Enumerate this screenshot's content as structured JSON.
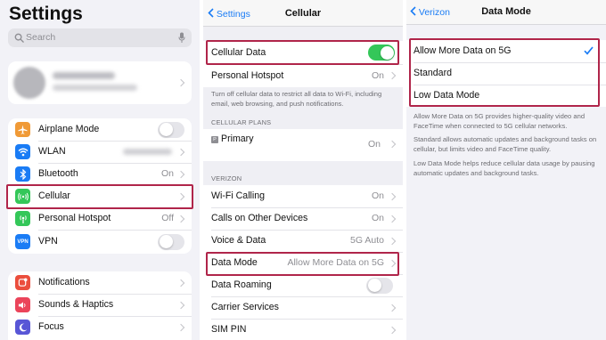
{
  "settings": {
    "title": "Settings",
    "search_placeholder": "Search",
    "group1": [
      {
        "label": "Airplane Mode",
        "icon": "airplane-icon",
        "color": "#f09a37",
        "control": "toggle",
        "on": false
      },
      {
        "label": "WLAN",
        "icon": "wifi-icon",
        "color": "#1a7cf5",
        "control": "blurred"
      },
      {
        "label": "Bluetooth",
        "icon": "bluetooth-icon",
        "color": "#1a7cf5",
        "value": "On"
      },
      {
        "label": "Cellular",
        "icon": "cellular-icon",
        "color": "#34c759"
      },
      {
        "label": "Personal Hotspot",
        "icon": "hotspot-icon",
        "color": "#34c759",
        "value": "Off"
      },
      {
        "label": "VPN",
        "icon": "vpn-icon",
        "color": "#1a7cf5",
        "control": "toggle",
        "on": false
      }
    ],
    "group2": [
      {
        "label": "Notifications",
        "icon": "bell-icon",
        "color": "#eb4e3d"
      },
      {
        "label": "Sounds & Haptics",
        "icon": "speaker-icon",
        "color": "#eb445a"
      },
      {
        "label": "Focus",
        "icon": "moon-icon",
        "color": "#5856d6"
      }
    ]
  },
  "cellular": {
    "back_label": "Settings",
    "title": "Cellular",
    "cellular_data_label": "Cellular Data",
    "cellular_data_on": true,
    "hotspot_label": "Personal Hotspot",
    "hotspot_value": "On",
    "description": "Turn off cellular data to restrict all data to Wi-Fi, including email, web browsing, and push notifications.",
    "plans_header": "CELLULAR PLANS",
    "primary_badge": "P",
    "primary_label": "Primary",
    "primary_value": "On",
    "carrier_header": "VERIZON",
    "carrier_rows": [
      {
        "label": "Wi-Fi Calling",
        "value": "On"
      },
      {
        "label": "Calls on Other Devices",
        "value": "On"
      },
      {
        "label": "Voice & Data",
        "value": "5G Auto"
      },
      {
        "label": "Data Mode",
        "value": "Allow More Data on 5G"
      },
      {
        "label": "Data Roaming",
        "control": "toggle"
      },
      {
        "label": "Carrier Services"
      },
      {
        "label": "SIM PIN"
      }
    ]
  },
  "data_mode": {
    "back_label": "Verizon",
    "title": "Data Mode",
    "options": [
      "Allow More Data on 5G",
      "Standard",
      "Low Data Mode"
    ],
    "selected_index": 0,
    "notes": [
      "Allow More Data on 5G provides higher-quality video and FaceTime when connected to 5G cellular networks.",
      "Standard allows automatic updates and background tasks on cellular, but limits video and FaceTime quality.",
      "Low Data Mode helps reduce cellular data usage by pausing automatic updates and background tasks."
    ]
  },
  "colors": {
    "accent": "#1a7cf5",
    "highlight": "#b0254a",
    "toggle_on": "#34c759"
  }
}
